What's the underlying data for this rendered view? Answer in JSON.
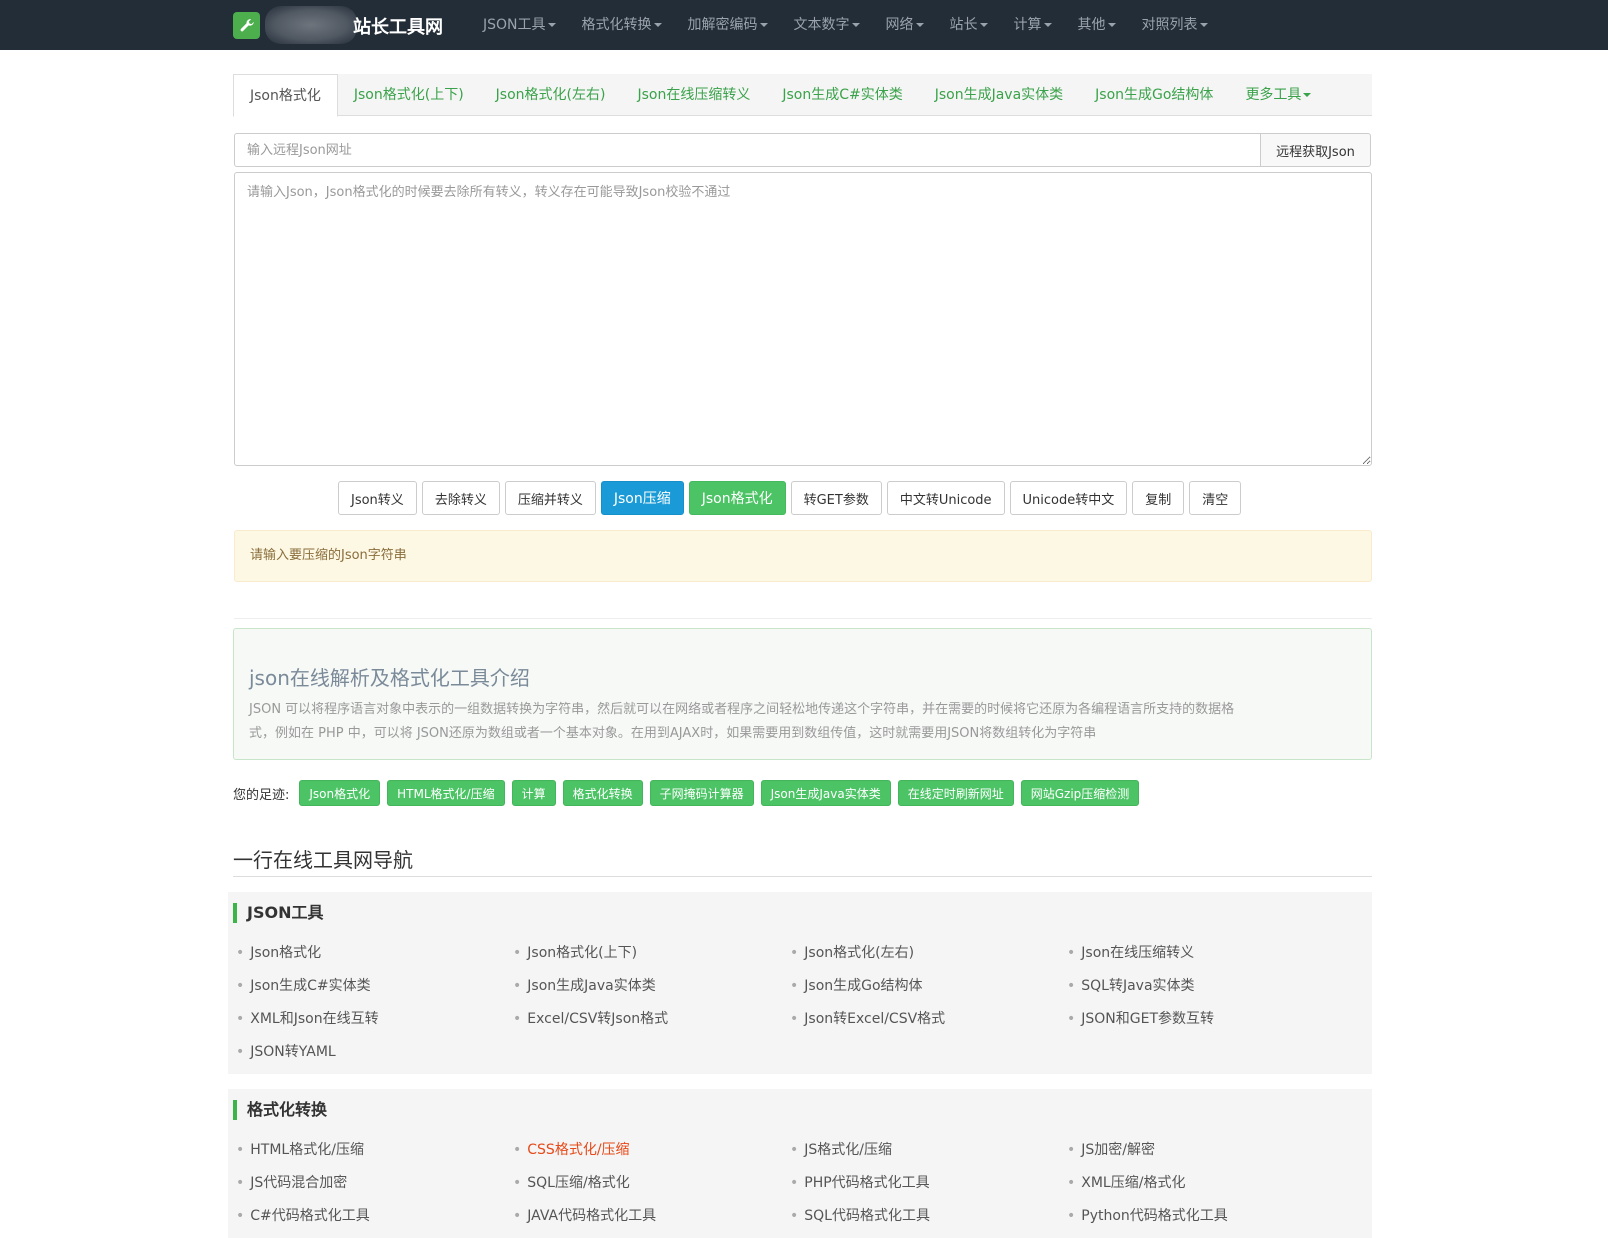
{
  "nav": {
    "brand": "站长工具网",
    "menu": [
      "JSON工具",
      "格式化转换",
      "加解密编码",
      "文本数字",
      "网络",
      "站长",
      "计算",
      "其他",
      "对照列表"
    ]
  },
  "tabs": [
    "Json格式化",
    "Json格式化(上下)",
    "Json格式化(左右)",
    "Json在线压缩转义",
    "Json生成C#实体类",
    "Json生成Java实体类",
    "Json生成Go结构体",
    "更多工具"
  ],
  "remote": {
    "placeholder": "输入远程Json网址",
    "button": "远程获取Json"
  },
  "editor": {
    "placeholder": "请输入Json，Json格式化的时候要去除所有转义，转义存在可能导致Json校验不通过"
  },
  "buttons": [
    "Json转义",
    "去除转义",
    "压缩并转义",
    "Json压缩",
    "Json格式化",
    "转GET参数",
    "中文转Unicode",
    "Unicode转中文",
    "复制",
    "清空"
  ],
  "alert": "请输入要压缩的Json字符串",
  "intro": {
    "title": "json在线解析及格式化工具介绍",
    "line1": "JSON 可以将程序语言对象中表示的一组数据转换为字符串，然后就可以在网络或者程序之间轻松地传递这个字符串，并在需要的时候将它还原为各编程语言所支持的数据格",
    "line2": "式，例如在 PHP 中，可以将 JSON还原为数组或者一个基本对象。在用到AJAX时，如果需要用到数组传值，这时就需要用JSON将数组转化为字符串"
  },
  "footprints": {
    "label": "您的足迹:",
    "tags": [
      "Json格式化",
      "HTML格式化/压缩",
      "计算",
      "格式化转换",
      "子网掩码计算器",
      "Json生成Java实体类",
      "在线定时刷新网址",
      "网站Gzip压缩检测"
    ]
  },
  "nav_title": "一行在线工具网导航",
  "sections": [
    {
      "title": "JSON工具",
      "items": [
        "Json格式化",
        "Json格式化(上下)",
        "Json格式化(左右)",
        "Json在线压缩转义",
        "Json生成C#实体类",
        "Json生成Java实体类",
        "Json生成Go结构体",
        "SQL转Java实体类",
        "XML和Json在线互转",
        "Excel/CSV转Json格式",
        "Json转Excel/CSV格式",
        "JSON和GET参数互转",
        "JSON转YAML"
      ]
    },
    {
      "title": "格式化转换",
      "items": [
        "HTML格式化/压缩",
        "CSS格式化/压缩",
        "JS格式化/压缩",
        "JS加密/解密",
        "JS代码混合加密",
        "SQL压缩/格式化",
        "PHP代码格式化工具",
        "XML压缩/格式化",
        "C#代码格式化工具",
        "JAVA代码格式化工具",
        "SQL代码格式化工具",
        "Python代码格式化工具"
      ]
    }
  ],
  "colors": {
    "navbar": "#222d38",
    "accent_green": "#4cc466",
    "accent_blue": "#1a9bd7",
    "highlight_link": "#e64a19"
  }
}
